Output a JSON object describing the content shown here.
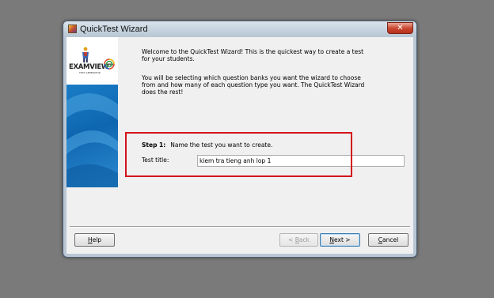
{
  "window": {
    "title": "QuickTest Wizard",
    "close_glyph": "✕",
    "app_icon": "quicktest-app-icon"
  },
  "sidebar": {
    "logo_text": "EXAMVIEW",
    "logo_superscript": "PRO",
    "logo_subtitle": "TEST GENERATOR",
    "accent_color": "#1a7cc6"
  },
  "content": {
    "welcome_line1": "Welcome to the QuickTest Wizard!  This is the quickest way to create a test",
    "welcome_line2": "for your students.",
    "intro_line1": "You will be selecting which question banks you want the wizard to choose",
    "intro_line2": "from and how many of each question type you want.  The QuickTest Wizard",
    "intro_line3": "does the rest!",
    "step_number": "Step 1:",
    "step_text": "Name the test you want to create.",
    "test_title_label": "Test title:",
    "test_title_value": "kiem tra tieng anh lop 1"
  },
  "highlight": {
    "color": "#d3141c"
  },
  "buttons": {
    "help": {
      "first": "H",
      "rest": "elp"
    },
    "back": {
      "prefix": "< ",
      "first": "B",
      "rest": "ack"
    },
    "next": {
      "first": "N",
      "rest": "ext >"
    },
    "cancel": {
      "first": "C",
      "rest": "ancel"
    }
  }
}
